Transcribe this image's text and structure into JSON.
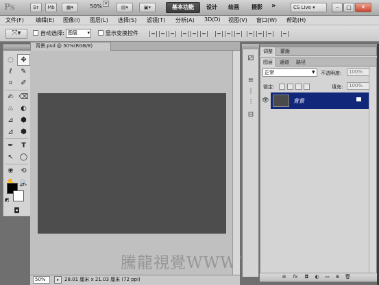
{
  "appbar": {
    "app_logo": "Ps",
    "br_label": "Br",
    "mb_label": "Mb",
    "zoom": "50%",
    "workspace_active": "基本功能",
    "workspaces": [
      "设计",
      "绘画",
      "摄影"
    ],
    "more": "»",
    "cslive": "CS Live",
    "cslive_arrow": "▾",
    "win_min": "–",
    "win_restore": "□",
    "win_close": "✕"
  },
  "menu": [
    "文件(F)",
    "编辑(E)",
    "图像(I)",
    "图层(L)",
    "选择(S)",
    "滤镜(T)",
    "分析(A)",
    "3D(D)",
    "视图(V)",
    "窗口(W)",
    "帮助(H)"
  ],
  "options": {
    "tool_icon": "⤧",
    "auto_select_label": "自动选择:",
    "auto_select_value": "图层",
    "show_transform_label": "显示变换控件"
  },
  "document": {
    "tab_title": "背景.psd @ 50%(RGB/8)",
    "close_glyph": "×",
    "zoom": "50%",
    "status_icon": "▸",
    "status": "28.01 厘米 x 21.03 厘米 (72 ppi)",
    "watermark": "騰龍視覺WWW.TLVI.NET"
  },
  "tools": {
    "items": [
      "◌",
      "✥",
      "ℓ",
      "✎",
      "⌗",
      "✐",
      "✍",
      "⌫",
      "♨",
      "◐",
      "⊿",
      "⬢",
      "✒",
      "T",
      "↖",
      "◯",
      "❀",
      "⟲",
      "✋",
      "🔍"
    ],
    "mode_glyph": "◘"
  },
  "panels": {
    "adjust_tabs": [
      "调整",
      "蒙版"
    ],
    "layer_tabs": [
      "图层",
      "通道",
      "路径"
    ],
    "blend_mode": "正常",
    "opacity_label": "不透明度:",
    "opacity": "100%",
    "lock_label": "锁定:",
    "fill_label": "填充:",
    "fill": "100%",
    "layer_name": "背景",
    "eye_glyph": "👁",
    "footer_icons": [
      "⊗",
      "fx",
      "◘",
      "◐",
      "▭",
      "⊞",
      "🗑"
    ],
    "mid_icons": [
      "⚂",
      "≡",
      "ᛁ",
      "⫶",
      "⊟"
    ]
  },
  "colors": {
    "foreground": "#000000",
    "background": "#ffffff",
    "selection": "#10277a",
    "canvas": "#4d4d4d"
  }
}
